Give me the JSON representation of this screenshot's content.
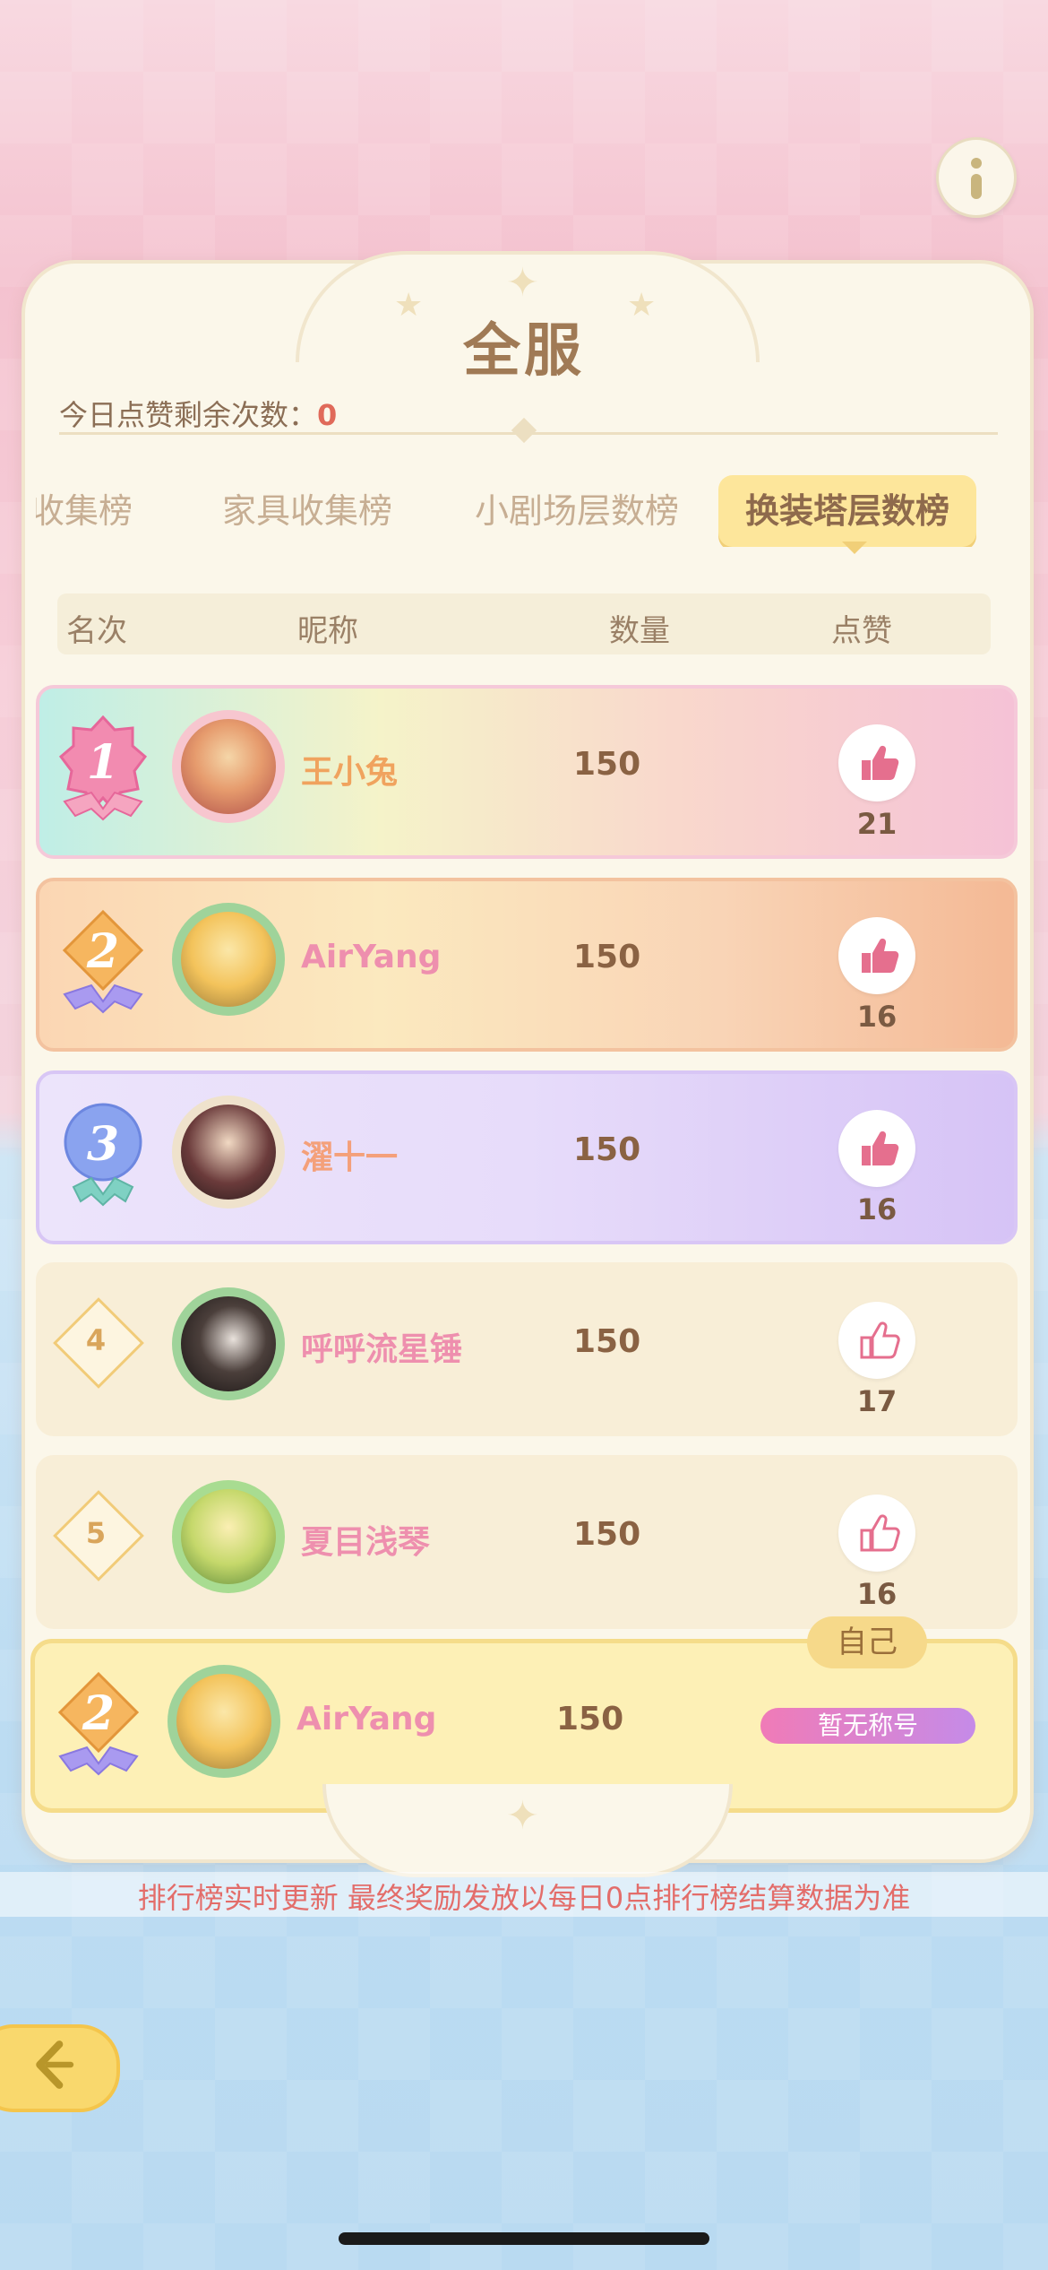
{
  "title": "全服",
  "likes_remaining_label": "今日点赞剩余次数：",
  "likes_remaining_value": "0",
  "tabs": [
    {
      "label": "收集榜"
    },
    {
      "label": "家具收集榜"
    },
    {
      "label": "小剧场层数榜"
    },
    {
      "label": "换装塔层数榜",
      "active": true
    }
  ],
  "columns": {
    "rank": "名次",
    "nickname": "昵称",
    "count": "数量",
    "like": "点赞"
  },
  "rows": [
    {
      "rank": "1",
      "nickname": "王小兔",
      "count": "150",
      "likes": "21"
    },
    {
      "rank": "2",
      "nickname": "AirYang",
      "count": "150",
      "likes": "16"
    },
    {
      "rank": "3",
      "nickname": "濯十一",
      "count": "150",
      "likes": "16"
    },
    {
      "rank": "4",
      "nickname": "呼呼流星锤",
      "count": "150",
      "likes": "17"
    },
    {
      "rank": "5",
      "nickname": "夏目浅琴",
      "count": "150",
      "likes": "16"
    }
  ],
  "self": {
    "tag": "自己",
    "rank": "2",
    "nickname": "AirYang",
    "count": "150",
    "title_badge": "暂无称号"
  },
  "footer": "排行榜实时更新 最终奖励发放以每日0点排行榜结算数据为准",
  "icons": {
    "info": "info-icon",
    "back": "back-arrow-icon",
    "like": "thumbs-up-icon"
  }
}
